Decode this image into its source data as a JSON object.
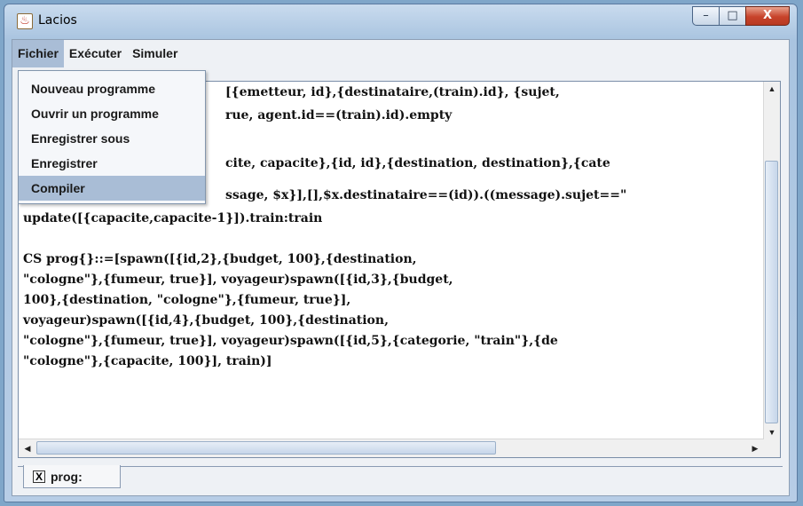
{
  "window": {
    "title": "Lacios",
    "app_icon": "java-cup-icon"
  },
  "window_controls": {
    "minimize": "–",
    "maximize": "□",
    "close": "X"
  },
  "menubar": {
    "items": [
      {
        "label": "Fichier"
      },
      {
        "label": "Exécuter"
      },
      {
        "label": "Simuler"
      }
    ]
  },
  "dropdown": {
    "items": [
      {
        "label": "Nouveau programme"
      },
      {
        "label": "Ouvrir un programme"
      },
      {
        "label": "Enregistrer sous"
      },
      {
        "label": "Enregistrer"
      },
      {
        "label": "Compiler",
        "highlighted": true
      }
    ]
  },
  "editor": {
    "lines": [
      "[{emetteur, id},{destinataire,(train).id}, {sujet,",
      "rue, agent.id==(train).id).empty",
      "cite, capacite},{id, id},{destination, destination},{cate",
      "ssage, $x}],[],$x.destinataire==(id)).((message).sujet==\"",
      "update([{capacite,capacite-1}]).train:train",
      "CS prog{}::=[spawn([{id,2},{budget, 100},{destination,",
      "\"cologne\"},{fumeur, true}], voyageur)spawn([{id,3},{budget,",
      "100},{destination, \"cologne\"},{fumeur, true}],",
      "voyageur)spawn([{id,4},{budget, 100},{destination,",
      "\"cologne\"},{fumeur, true}], voyageur)spawn([{id,5},{categorie, \"train\"},{de",
      "\"cologne\"},{capacite, 100}], train)]"
    ]
  },
  "tabs": [
    {
      "label": "prog:",
      "close_glyph": "X"
    }
  ],
  "colors": {
    "menu_highlight": "#a9bdd6",
    "close_button": "#c7432b",
    "window_frame": "#a9c4e0"
  }
}
